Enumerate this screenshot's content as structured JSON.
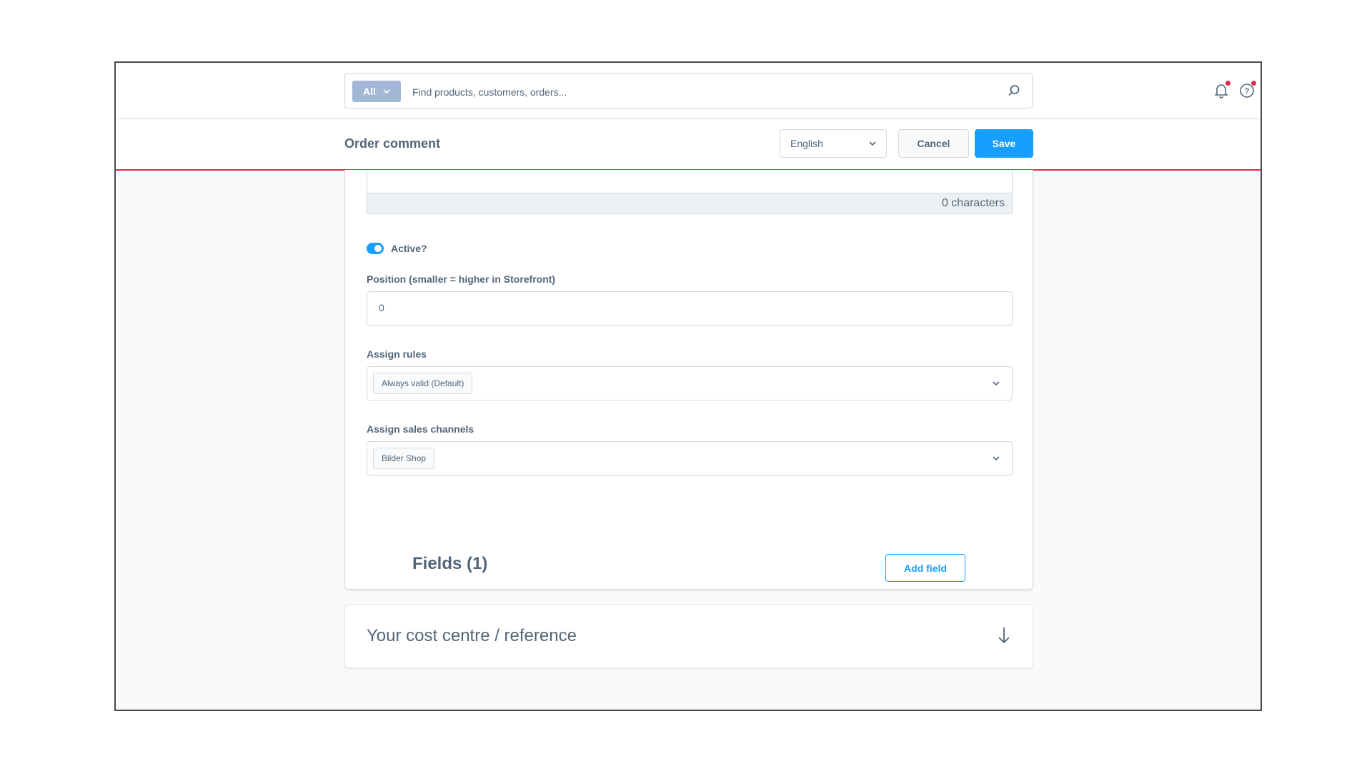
{
  "topbar": {
    "search_type": "All",
    "search_placeholder": "Find products, customers, orders..."
  },
  "smartbar": {
    "title": "Order comment",
    "language": "English",
    "cancel_label": "Cancel",
    "save_label": "Save"
  },
  "form": {
    "char_count": "0 characters",
    "active_label": "Active?",
    "active": true,
    "position_label": "Position (smaller = higher in Storefront)",
    "position_value": "0",
    "assign_rules_label": "Assign rules",
    "assign_rules_chip": "Always valid (Default)",
    "sales_channels_label": "Assign sales channels",
    "sales_channels_chip": "Bilder Shop"
  },
  "fields": {
    "title": "Fields (1)",
    "add_label": "Add field",
    "items": [
      {
        "label": "Your cost centre / reference"
      }
    ]
  },
  "colors": {
    "primary": "#189eff",
    "accent_red": "#de294c",
    "text": "#52667a",
    "chip_bg": "#a2b8d6"
  },
  "icons": [
    "chevron-down-icon",
    "search-icon",
    "bell-icon",
    "help-icon",
    "arrow-down-icon"
  ]
}
